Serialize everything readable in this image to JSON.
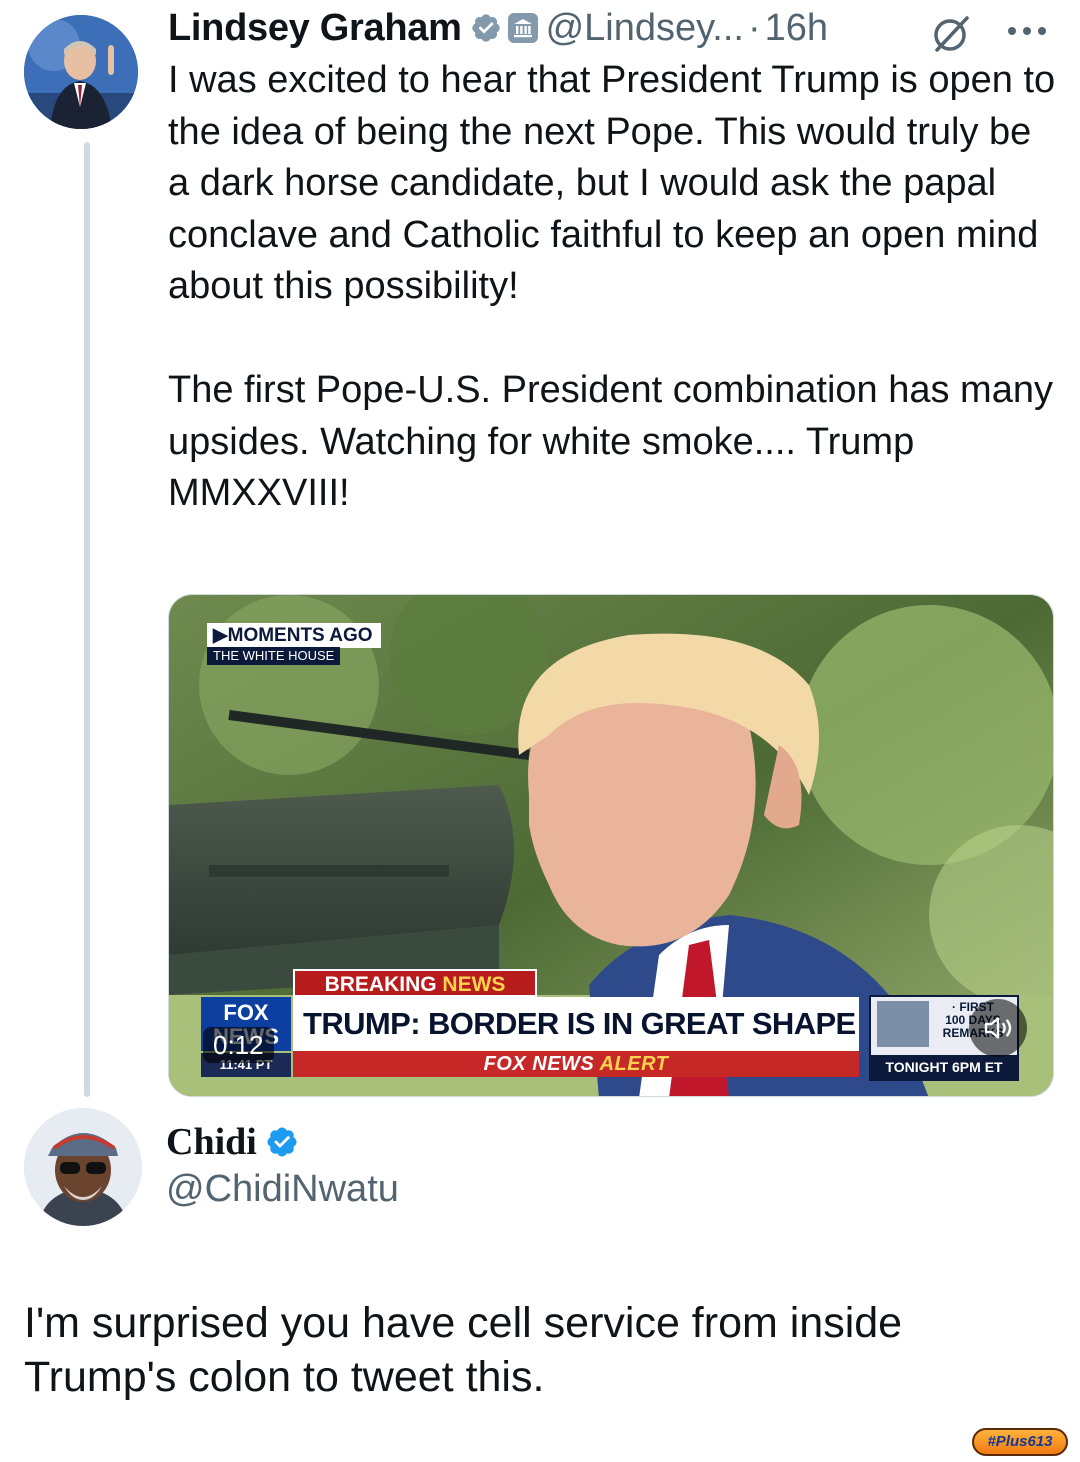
{
  "tweet1": {
    "author_name": "Lindsey Graham",
    "handle": "@Lindsey...",
    "separator": "·",
    "time": "16h",
    "icons": {
      "verified": "verified-badge-icon",
      "affiliation": "government-building-icon",
      "grok": "grok-icon",
      "more": "more-options-icon"
    },
    "paragraphs": [
      "I was excited to hear that President Trump is open to the idea of being the next Pope. This would truly be a dark horse candidate, but I would ask the papal conclave and Catholic faithful to keep an open mind about this possibility!",
      "The first Pope-U.S. President combination has many upsides. Watching for white smoke.... Trump MMXXVIII!"
    ],
    "video": {
      "moments_ago": "▶MOMENTS AGO",
      "location": "THE WHITE HOUSE",
      "breaking_word": "BREAKING",
      "news_word": "NEWS",
      "headline": "TRUMP: BORDER IS IN GREAT SHAPE",
      "alert_prefix": "FOX NEWS",
      "alert_word": "ALERT",
      "logo_text": "FOX NEWS",
      "clock": "11:41 PT",
      "inset_line1": "· FIRST",
      "inset_line2": "100 DAYS",
      "inset_line3": "REMARKS",
      "inset_tonight": "TONIGHT 6PM ET",
      "duration": "0:12",
      "mute_icon": "speaker-muted-icon"
    }
  },
  "tweet2": {
    "author_name": "Chidi",
    "handle": "@ChidiNwatu",
    "verified_icon": "verified-badge-icon",
    "body": "I'm surprised you have cell service from inside Trump's colon to tweet this."
  },
  "watermark": "#Plus613",
  "colors": {
    "text": "#0f1419",
    "secondary": "#536471",
    "verified": "#1d9bf0",
    "thread_line": "#cfd9de",
    "fox_red": "#c62828",
    "fox_navy": "#0b1a3a"
  }
}
